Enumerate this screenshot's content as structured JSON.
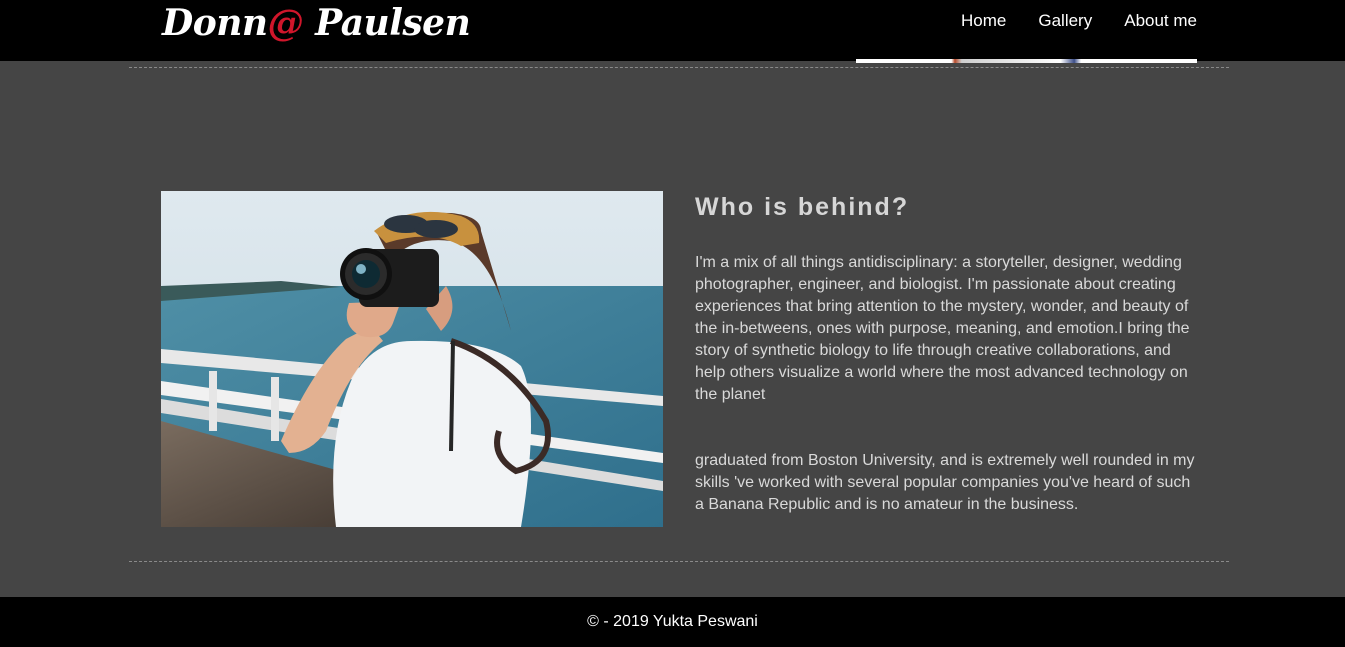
{
  "header": {
    "logo_part1": "Donn",
    "logo_at": "@",
    "logo_part2": " Paulsen",
    "nav": [
      "Home",
      "Gallery",
      "About me"
    ]
  },
  "about": {
    "heading": "Who is behind?",
    "paragraph1": "I'm a mix of all things antidisciplinary: a storyteller, designer, wedding photographer, engineer, and biologist. I'm passionate about creating experiences that bring attention to the mystery, wonder, and beauty of the in-betweens, ones with purpose, meaning, and emotion.I bring the story of synthetic biology to life through creative collaborations, and help others visualize a world where the most advanced technology on the planet",
    "paragraph2": "graduated from Boston University, and is extremely well rounded in my skills 've worked with several popular companies you've heard of such a Banana Republic and is no amateur in the business."
  },
  "footer": {
    "copyright": "© - 2019 Yukta Peswani"
  },
  "colors": {
    "background": "#454545",
    "bar": "#000000",
    "logo_accent": "#d0162b",
    "text": "#d9d9d9"
  }
}
